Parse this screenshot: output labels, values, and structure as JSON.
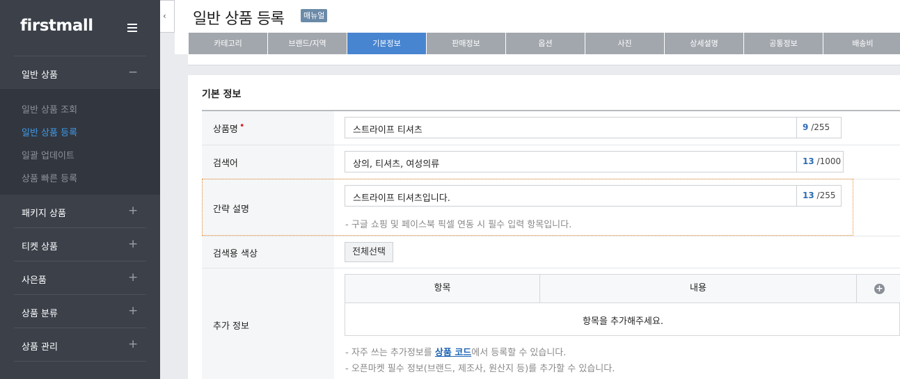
{
  "sidebar": {
    "logo": "firstmall",
    "sections": [
      {
        "label": "일반 상품",
        "sign": "−"
      },
      {
        "label": "패키지 상품",
        "sign": "+"
      },
      {
        "label": "티켓 상품",
        "sign": "+"
      },
      {
        "label": "사은품",
        "sign": "+"
      },
      {
        "label": "상품 분류",
        "sign": "+"
      },
      {
        "label": "상품 관리",
        "sign": "+"
      }
    ],
    "sub_items": [
      {
        "label": "일반 상품 조회"
      },
      {
        "label": "일반 상품 등록"
      },
      {
        "label": "일괄 업데이트"
      },
      {
        "label": "상품 빠른 등록"
      }
    ]
  },
  "header": {
    "title": "일반 상품 등록",
    "manual_badge": "매뉴얼",
    "collapse_glyph": "‹"
  },
  "tabs": [
    {
      "label": "카테고리"
    },
    {
      "label": "브랜드/지역"
    },
    {
      "label": "기본정보"
    },
    {
      "label": "판매정보"
    },
    {
      "label": "옵션"
    },
    {
      "label": "사진"
    },
    {
      "label": "상세설명"
    },
    {
      "label": "공통정보"
    },
    {
      "label": "배송비"
    }
  ],
  "active_tab": "기본정보",
  "form": {
    "section_title": "기본 정보",
    "product_name": {
      "label": "상품명",
      "required_mark": "•",
      "value": "스트라이프 티셔츠",
      "count": "9",
      "max": "/255"
    },
    "keywords": {
      "label": "검색어",
      "value": "상의, 티셔츠, 여성의류",
      "count": "13",
      "max": "/1000"
    },
    "short_desc": {
      "label": "간략 설명",
      "value": "스트라이프 티셔츠입니다.",
      "count": "13",
      "max": "/255",
      "hint": "-  구글 쇼핑 및 페이스북 픽셀 연동 시 필수 입력 항목입니다."
    },
    "search_color": {
      "label": "검색용 색상",
      "button": "전체선택"
    },
    "extra_info": {
      "label": "추가 정보",
      "col_item": "항목",
      "col_content": "내용",
      "add_glyph": "+",
      "empty": "항목을 추가해주세요.",
      "hint1_prefix": "-  자주 쓰는 추가정보를 ",
      "hint1_link": "상품 코드",
      "hint1_suffix": "에서 등록할 수 있습니다.",
      "hint2": "-  오픈마켓 필수 정보(브랜드, 제조사, 원산지 등)를 추가할 수 있습니다."
    }
  },
  "colors": {
    "sidebar_bg": "#3b4049",
    "active_tab": "#4785d0",
    "inactive_tab": "#a2a7ad",
    "active_sub_item": "#3f9be8",
    "required": "#e0242d",
    "counter": "#2d6cb5"
  }
}
